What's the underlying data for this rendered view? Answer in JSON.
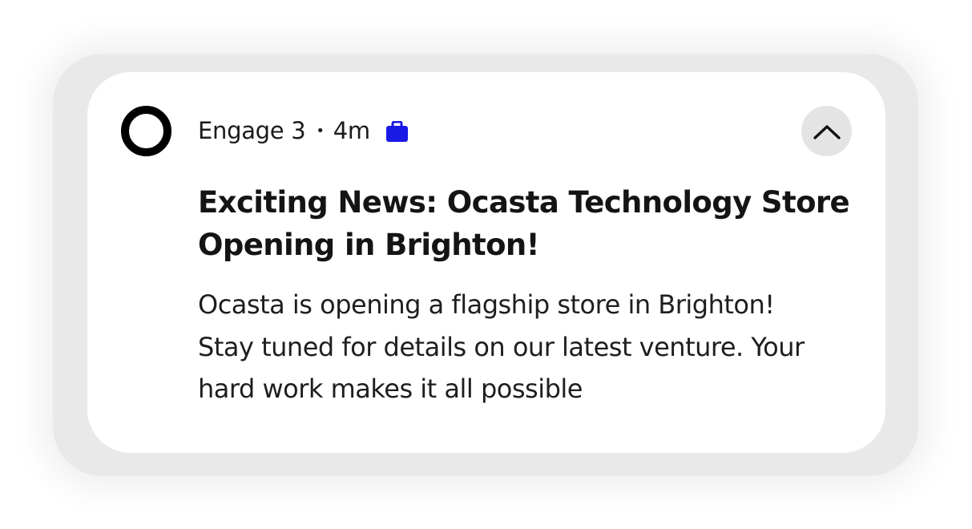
{
  "notification": {
    "app_name": "Engage 3",
    "separator": "•",
    "time": "4m",
    "badge_icon": "briefcase-icon",
    "badge_color": "#1a1ae6",
    "app_icon": "ring-icon",
    "expand_icon": "chevron-up-icon",
    "title_lines": [
      "Exciting News: Ocasta Technology Store",
      "Opening in Brighton!"
    ],
    "body_lines": [
      "Ocasta is opening a flagship store in Brighton!",
      "Stay tuned for details on our latest venture. Your",
      "hard work makes it all possible"
    ]
  },
  "colors": {
    "frame": "#e9e9e9",
    "card": "#ffffff",
    "button_bg": "#e4e4e4",
    "text": "#141414"
  }
}
